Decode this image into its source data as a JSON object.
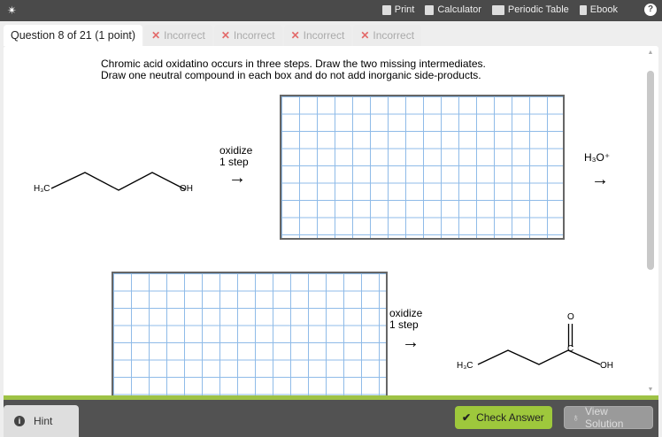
{
  "topbar": {
    "logo": "✴",
    "tools": [
      {
        "label": "Print",
        "icon": "printer-icon"
      },
      {
        "label": "Calculator",
        "icon": "calculator-icon"
      },
      {
        "label": "Periodic Table",
        "icon": "periodic-table-icon"
      },
      {
        "label": "Ebook",
        "icon": "book-icon"
      }
    ],
    "help": "?"
  },
  "tabs": {
    "question": "Question 8 of 21 (1 point)",
    "attempts": [
      "Incorrect",
      "Incorrect",
      "Incorrect",
      "Incorrect"
    ]
  },
  "prompt": {
    "line1": "Chromic acid oxidatino occurs in three steps. Draw the two missing intermediates.",
    "line2": "Draw one neutral compound in each box and do not add inorganic side-products."
  },
  "step1": {
    "line1": "oxidize",
    "line2": "1 step"
  },
  "step2": {
    "label": "H₃O⁺"
  },
  "step3": {
    "line1": "oxidize",
    "line2": "1 step"
  },
  "molecules": {
    "start": {
      "left": "H₃C",
      "right": "OH"
    },
    "product": {
      "left": "H₃C",
      "o": "O",
      "c": "C",
      "oh": "OH"
    }
  },
  "arrow": "→",
  "footer": {
    "hint": "Hint",
    "check": "Check Answer",
    "view": "View Solution"
  }
}
